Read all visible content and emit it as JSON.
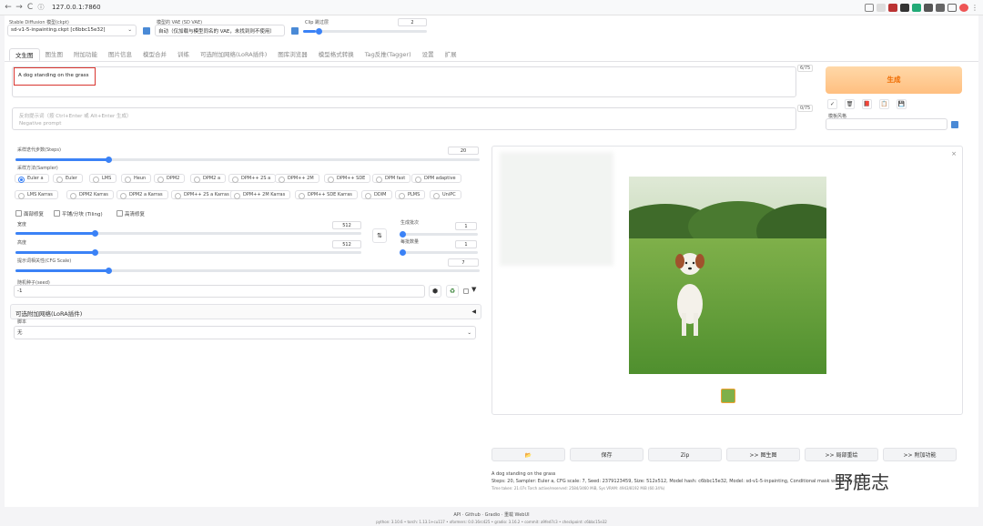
{
  "browser": {
    "url": "127.0.0.1:7860",
    "back": "←",
    "forward": "→",
    "reload": "C"
  },
  "top": {
    "model_label": "Stable Diffusion 模型(ckpt)",
    "model_value": "sd-v1-5-inpainting.ckpt [c6bbc15e32]",
    "vae_label": "模型的 VAE (SD VAE)",
    "vae_value": "自动（仅加载与模型同名的 VAE，未找到则不使用）",
    "clip_label": "Clip 跳过层",
    "clip_value": "2"
  },
  "tabs": [
    "文生图",
    "图生图",
    "附加功能",
    "图片信息",
    "模型合并",
    "训练",
    "可选附加网络(LoRA插件)",
    "图库浏览器",
    "模型格式转换",
    "Tag反推(Tagger)",
    "设置",
    "扩展"
  ],
  "prompt": {
    "value": "A dog standing on the grass",
    "count": "6/75"
  },
  "neg": {
    "hint": "反向提示词（按 Ctrl+Enter 或 Alt+Enter 生成）",
    "placeholder": "Negative prompt",
    "count": "0/75"
  },
  "generate": "生成",
  "style_label": "模板风格",
  "tools": [
    "✓",
    "🗑",
    "📕",
    "📋",
    "💾"
  ],
  "steps": {
    "label": "采样迭代步数(Steps)",
    "value": "20",
    "fraction": 0.2
  },
  "sampler": {
    "label": "采样方法(Sampler)",
    "row1": [
      "Euler a",
      "Euler",
      "LMS",
      "Heun",
      "DPM2",
      "DPM2 a",
      "DPM++ 2S a",
      "DPM++ 2M",
      "DPM++ SDE",
      "DPM fast",
      "DPM adaptive"
    ],
    "row2": [
      "LMS Karras",
      "DPM2 Karras",
      "DPM2 a Karras",
      "DPM++ 2S a Karras",
      "DPM++ 2M Karras",
      "DPM++ SDE Karras",
      "DDIM",
      "PLMS",
      "UniPC"
    ],
    "selected": "Euler a"
  },
  "checks": [
    "面部修复",
    "平铺/分块 (Tiling)",
    "高清修复"
  ],
  "width": {
    "label": "宽度",
    "value": "512",
    "fraction": 0.23
  },
  "height": {
    "label": "高度",
    "value": "512",
    "fraction": 0.23
  },
  "swap": "⇅",
  "batch_count": {
    "label": "生成批次",
    "value": "1",
    "fraction": 0.0
  },
  "batch_size": {
    "label": "每批数量",
    "value": "1",
    "fraction": 0.0
  },
  "cfg": {
    "label": "提示词相关性(CFG Scale)",
    "value": "7",
    "fraction": 0.2
  },
  "seed": {
    "label": "随机种子(seed)",
    "value": "-1"
  },
  "lora": {
    "label": "可选附加网络(LoRA插件)",
    "arrow": "◀"
  },
  "script": {
    "label": "脚本",
    "value": "无"
  },
  "output_buttons": [
    "📂",
    "保存",
    "Zip",
    ">> 图生图",
    ">> 局部重绘",
    ">> 附加功能"
  ],
  "info": {
    "prompt": "A dog standing on the grass",
    "params": "Steps: 20, Sampler: Euler a, CFG scale: 7, Seed: 2379123459, Size: 512x512, Model hash: c6bbc15e32, Model: sd-v1-5-inpainting, Conditional mask weight: 1.0",
    "time": "Time taken: 21.07s  Torch active/reserved: 2584/3460 MiB, Sys VRAM: 4943/8192 MiB (60.34%)"
  },
  "footer": {
    "links": "API · Github · Gradio · 重载 WebUI",
    "versions": "python: 3.10.6  •  torch: 1.13.1+cu117  •  xformers: 0.0.16rc425  •  gradio: 3.16.2  •  commit: a9fed7c3  •  checkpoint: c6bbc15e32"
  },
  "watermark": "野鹿志",
  "colors": {
    "accent": "#3b82f6",
    "generate": "#ffc98e",
    "highlight": "#d9352f"
  }
}
